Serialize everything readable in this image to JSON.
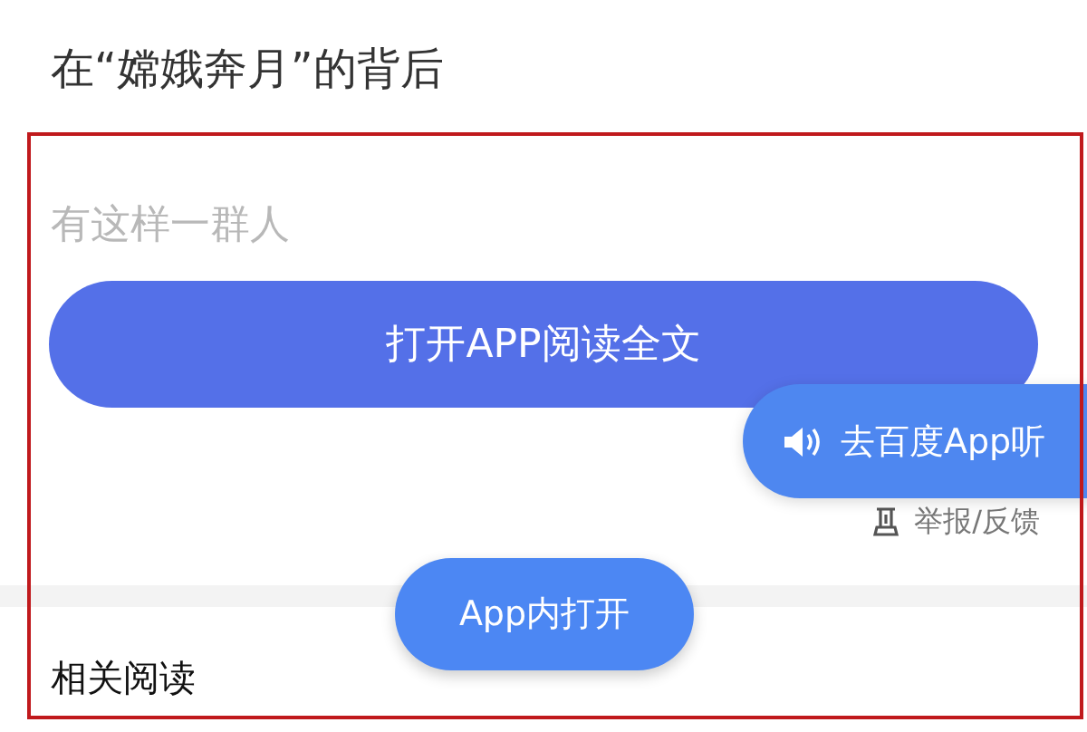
{
  "article": {
    "title": "在“嫦娥奔月”的背后",
    "faded_text": "有这样一群人"
  },
  "read_full_button": {
    "label": "打开APP阅读全文"
  },
  "listen_button": {
    "label": "去百度App听"
  },
  "report_link": {
    "label": "举报/反馈"
  },
  "open_in_app_button": {
    "label": "App内打开"
  },
  "related": {
    "heading": "相关阅读"
  }
}
